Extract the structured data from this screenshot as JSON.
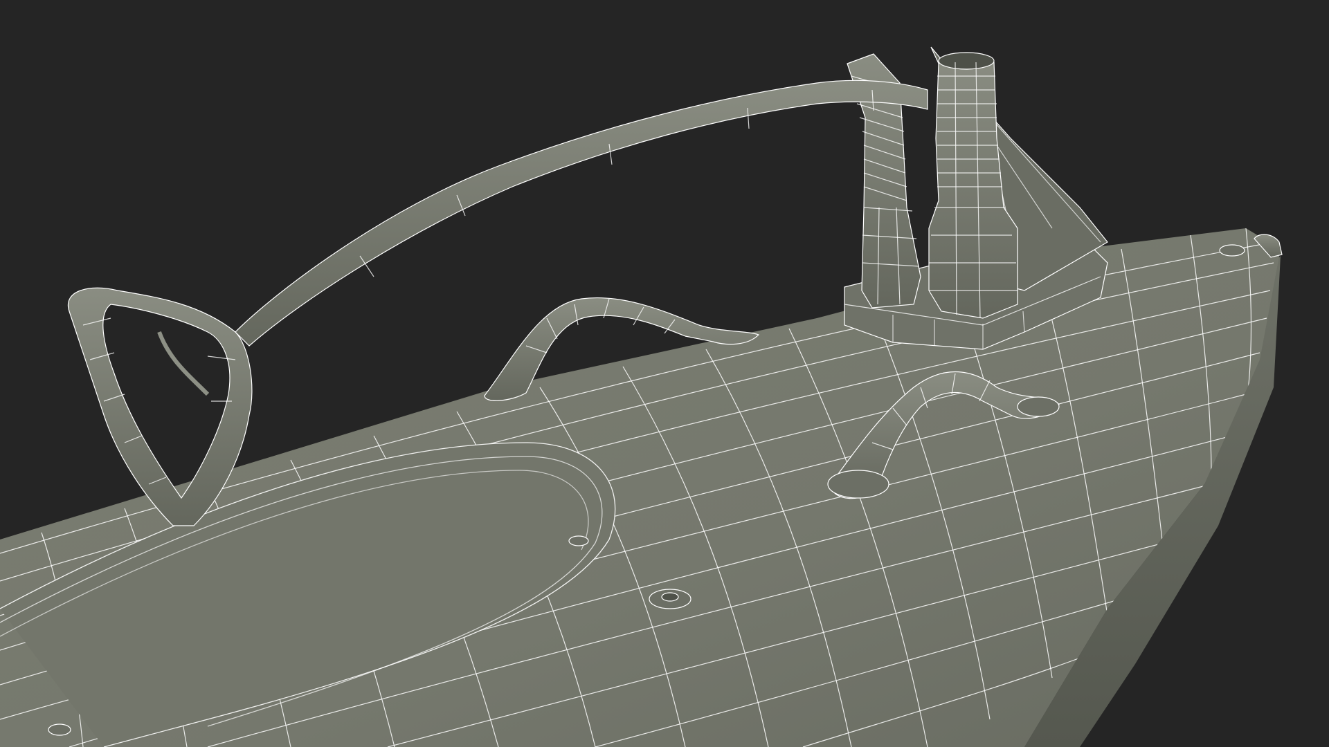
{
  "scene": {
    "background_color": "#252525",
    "surface_color": "#777a6f",
    "surface_dark_color": "#5f625a",
    "wire_color": "#ffffff",
    "subject": "wireframe-hull-with-handles-and-exhausts"
  }
}
